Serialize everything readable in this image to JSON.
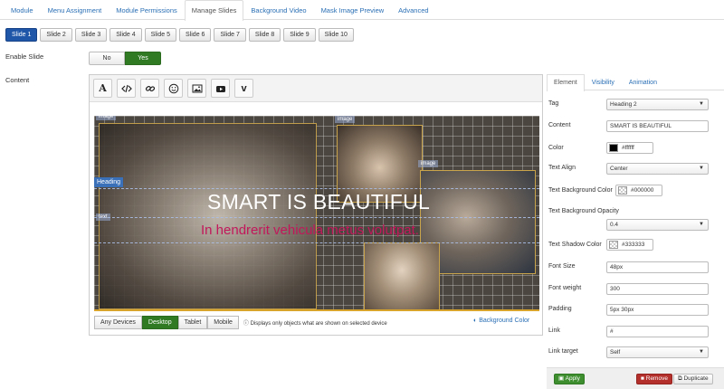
{
  "tabs": [
    {
      "label": "Module"
    },
    {
      "label": "Menu Assignment"
    },
    {
      "label": "Module Permissions"
    },
    {
      "label": "Manage Slides",
      "active": true
    },
    {
      "label": "Background Video"
    },
    {
      "label": "Mask Image Preview"
    },
    {
      "label": "Advanced"
    }
  ],
  "slides": [
    "Slide 1",
    "Slide 2",
    "Slide 3",
    "Slide 4",
    "Slide 5",
    "Slide 6",
    "Slide 7",
    "Slide 8",
    "Slide 9",
    "Slide 10"
  ],
  "active_slide": "Slide 1",
  "enable_slide": {
    "label": "Enable Slide",
    "no": "No",
    "yes": "Yes",
    "value": "Yes"
  },
  "content": {
    "label": "Content"
  },
  "toolbar": {
    "buttons": [
      "text-icon",
      "code-icon",
      "link-icon",
      "smiley-icon",
      "image-icon",
      "youtube-icon",
      "vimeo-icon"
    ],
    "text_glyph": "A",
    "vimeo_glyph": "v"
  },
  "canvas": {
    "heading_tag": "Heading",
    "heading_text": "SMART IS BEAUTIFUL",
    "sub_text": "In hendrerit vehicula metus volutpat.",
    "tags": [
      "image",
      "image",
      "image",
      "text"
    ]
  },
  "devices": {
    "buttons": [
      "Any Devices",
      "Desktop",
      "Tablet",
      "Mobile"
    ],
    "active": "Desktop",
    "note": "Displays only objects what are shown on selected device",
    "background_color": "Background Color"
  },
  "panel": {
    "tabs": [
      "Element",
      "Visibility",
      "Animation"
    ],
    "active_tab": "Element",
    "fields": {
      "tag": {
        "label": "Tag",
        "value": "Heading 2"
      },
      "content": {
        "label": "Content",
        "value": "SMART IS BEAUTIFUL"
      },
      "color": {
        "label": "Color",
        "value": "#ffffff",
        "swatch": "#000000"
      },
      "text_align": {
        "label": "Text Align",
        "value": "Center"
      },
      "text_bg_color": {
        "label": "Text Background Color",
        "value": "#000000"
      },
      "text_bg_opacity": {
        "label": "Text Background Opacity",
        "value": "0.4"
      },
      "text_shadow_color": {
        "label": "Text Shadow Color",
        "value": "#333333"
      },
      "font_size": {
        "label": "Font Size",
        "value": "48px"
      },
      "font_weight": {
        "label": "Font weight",
        "value": "300"
      },
      "padding": {
        "label": "Padding",
        "value": "5px 30px"
      },
      "link": {
        "label": "Link",
        "value": "#"
      },
      "link_target": {
        "label": "Link target",
        "value": "Self"
      }
    },
    "buttons": {
      "apply": "Apply",
      "remove": "Remove",
      "duplicate": "Duplicate"
    }
  },
  "colors": {
    "primary": "#1f56a8",
    "success": "#2f7a23",
    "danger": "#b3302c",
    "link": "#2a6fb5",
    "subtext": "#c2185b"
  }
}
